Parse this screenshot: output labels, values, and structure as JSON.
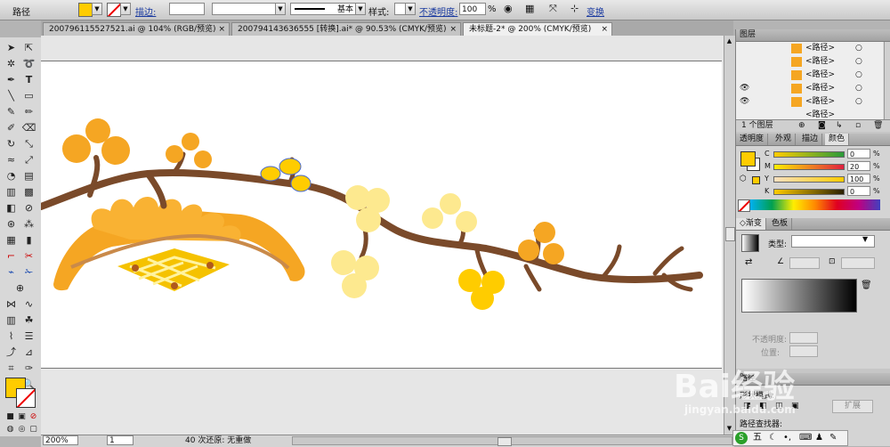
{
  "control_bar": {
    "selection_label": "路径",
    "stroke_label": "描边:",
    "basic_label": "基本",
    "style_label": "样式:",
    "opacity_label": "不透明度:",
    "opacity_value": "100",
    "percent": "%",
    "transform_label": "变换"
  },
  "doc_tabs": [
    {
      "label": "20079611552752​1.ai @ 104% (RGB/预览)"
    },
    {
      "label": "200794143636555 [转换].ai* @ 90.53% (CMYK/预览)"
    },
    {
      "label": "未标题-2* @ 200% (CMYK/预览)"
    }
  ],
  "status": {
    "zoom": "200%",
    "page": "1",
    "undo_text": "40 次还原: 无重做"
  },
  "layers_panel": {
    "title": "图层",
    "rows": [
      "<路径>",
      "<路径>",
      "<路径>",
      "<路径>",
      "<路径>",
      "<路径>"
    ],
    "footer": "1 个图层"
  },
  "color_panel": {
    "tabs": [
      "透明度",
      "外观",
      "描边",
      "颜色"
    ],
    "channels": [
      {
        "name": "C",
        "value": "0"
      },
      {
        "name": "M",
        "value": "20"
      },
      {
        "name": "Y",
        "value": "100"
      },
      {
        "name": "K",
        "value": "0"
      }
    ],
    "percent": "%"
  },
  "gradient_panel": {
    "tabs": [
      "渐变",
      "色板"
    ],
    "type_label": "类型:",
    "opacity_label": "不透明度:",
    "position_label": "位置:"
  },
  "bottom_panel": {
    "title": "路径",
    "mode_label": "形状模式:",
    "expand_label": "扩展",
    "finder_label": "路径查找器:"
  },
  "watermark": {
    "brand": "Bai经验",
    "url": "jingyan.baidu.com"
  },
  "ime": {
    "label": "五"
  },
  "colors": {
    "fill": "#ffcc00",
    "branch": "#7a4a2a",
    "gold": "#f5a623",
    "pale": "#fde98f"
  }
}
